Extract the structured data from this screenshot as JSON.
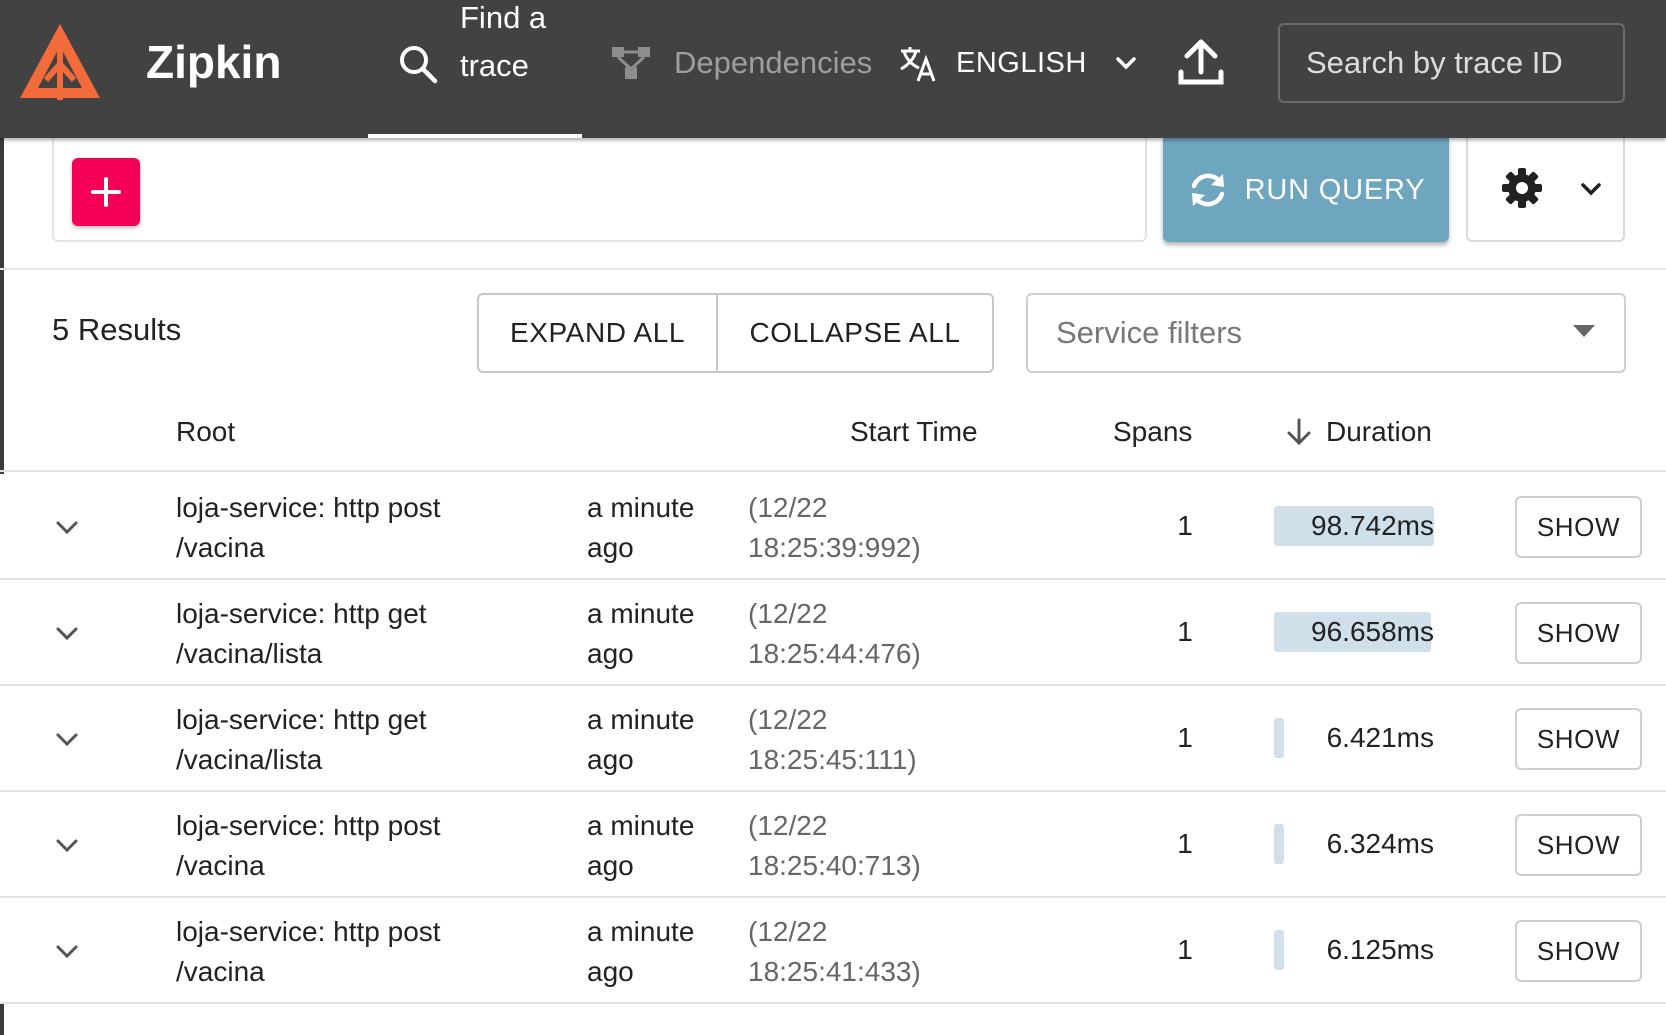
{
  "header": {
    "brand": "Zipkin",
    "find_trace": "Find a trace",
    "dependencies": "Dependencies",
    "language": "ENGLISH",
    "trace_search_placeholder": "Search by trace ID"
  },
  "query": {
    "run_query_label": "RUN QUERY"
  },
  "results": {
    "count_label": "5 Results",
    "expand_all_label": "EXPAND ALL",
    "collapse_all_label": "COLLAPSE ALL",
    "service_filters_placeholder": "Service filters"
  },
  "table": {
    "columns": {
      "root": "Root",
      "start_time": "Start Time",
      "spans": "Spans",
      "duration": "Duration"
    },
    "show_label": "SHOW",
    "rows": [
      {
        "root": "loja-service: http post /vacina",
        "relative_time": "a minute ago",
        "absolute_time": "(12/22 18:25:39:992)",
        "spans": "1",
        "duration": "98.742ms",
        "duration_fraction": 1.0
      },
      {
        "root": "loja-service: http get /vacina/lista",
        "relative_time": "a minute ago",
        "absolute_time": "(12/22 18:25:44:476)",
        "spans": "1",
        "duration": "96.658ms",
        "duration_fraction": 0.979
      },
      {
        "root": "loja-service: http get /vacina/lista",
        "relative_time": "a minute ago",
        "absolute_time": "(12/22 18:25:45:111)",
        "spans": "1",
        "duration": "6.421ms",
        "duration_fraction": 0.065
      },
      {
        "root": "loja-service: http post /vacina",
        "relative_time": "a minute ago",
        "absolute_time": "(12/22 18:25:40:713)",
        "spans": "1",
        "duration": "6.324ms",
        "duration_fraction": 0.064
      },
      {
        "root": "loja-service: http post /vacina",
        "relative_time": "a minute ago",
        "absolute_time": "(12/22 18:25:41:433)",
        "spans": "1",
        "duration": "6.125ms",
        "duration_fraction": 0.062
      }
    ]
  },
  "colors": {
    "header_bg": "#424242",
    "logo_orange": "#f26b3a",
    "add_button": "#f50057",
    "run_query_button": "#6ea6c0",
    "duration_bar": "#cfe0ea"
  },
  "icons": {
    "logo": "zipkin-logo-icon",
    "find": "search-icon",
    "dependencies": "dependencies-icon",
    "language": "translate-icon",
    "upload": "upload-icon",
    "add": "plus-icon",
    "run": "refresh-icon",
    "settings": "gear-icon",
    "sort": "arrow-down-icon",
    "row_expand": "chevron-down-icon"
  }
}
